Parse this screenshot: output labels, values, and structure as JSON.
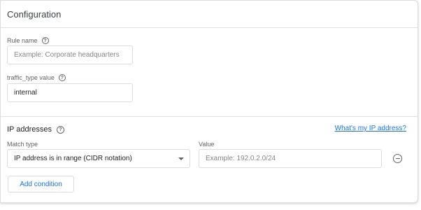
{
  "card": {
    "title": "Configuration"
  },
  "rule_name": {
    "label": "Rule name",
    "placeholder": "Example: Corporate headquarters"
  },
  "traffic_type": {
    "label": "traffic_type value",
    "value": "internal"
  },
  "ip_addresses": {
    "title": "IP addresses",
    "link": "What's my IP address?",
    "match_type": {
      "label": "Match type",
      "selected": "IP address is in range (CIDR notation)"
    },
    "value": {
      "label": "Value",
      "placeholder": "Example: 192.0.2.0/24"
    },
    "add_condition": "Add condition"
  },
  "colors": {
    "accent": "#1a73e8",
    "border": "#dadce0",
    "text": "#202124",
    "muted": "#5f6368"
  },
  "icons": {
    "help": "help-circle-icon",
    "remove": "remove-circle-icon",
    "dropdown": "dropdown-arrow-icon"
  }
}
